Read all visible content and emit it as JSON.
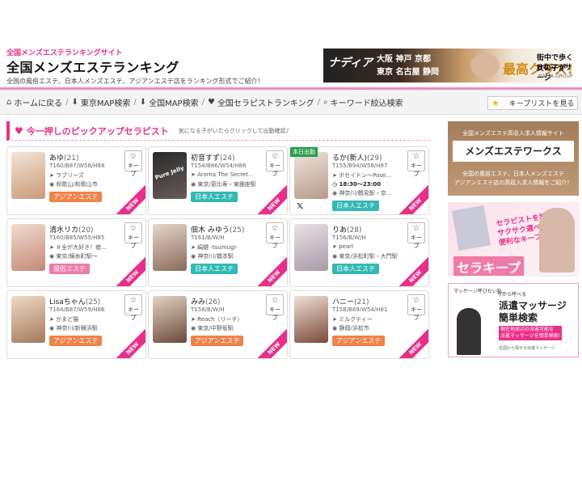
{
  "header": {
    "tagline": "全国メンズエステランキングサイト",
    "title": "全国メンズエステランキング",
    "description": "全国の風俗エステ、日本人メンズエステ、アジアンエステ店をランキング形式でご紹介！"
  },
  "top_banner": {
    "brand": "ナディア",
    "cities_line1": "大阪 神戸 京都",
    "cities_line2": "東京 名古屋 静岡",
    "highlight": "最高クラス!",
    "copy_line1": "街中で歩く女の子が",
    "copy_line2": "Hなマッサージ",
    "group": "NADIA GROUP"
  },
  "nav": {
    "items": [
      {
        "icon": "home-icon",
        "glyph": "⌂",
        "label": "ホームに戻る"
      },
      {
        "icon": "arrow-down-icon",
        "glyph": "⬇",
        "label": "東京MAP検索"
      },
      {
        "icon": "arrow-down-icon",
        "glyph": "⬇",
        "label": "全国MAP検索"
      },
      {
        "icon": "heart-icon",
        "glyph": "♥",
        "label": "全国セラピストランキング"
      },
      {
        "icon": "search-icon",
        "glyph": "⌕",
        "label": "キーワード絞込検索"
      }
    ],
    "keep_list_label": "キープリストを見る"
  },
  "section": {
    "title": "今一押しのピックアップセラピスト",
    "subtitle": "気になる子がいたらクリックして出勤確認♪"
  },
  "keep_label": "キープ",
  "new_label": "NEW",
  "today_label": "本日出勤",
  "colors": {
    "accent": "#e8308a",
    "asian": "#f0834a",
    "japanese": "#32b9b4",
    "fuzoku": "#f07aa8"
  },
  "cards": [
    {
      "name": "あゆ",
      "age": "(21)",
      "sizes": "T160/B87/W56/H88",
      "shop": "ラブリーズ",
      "area": "和歌山/和歌山市",
      "tag": "アジアンエステ",
      "tag_type": "asian",
      "photo": [
        "#f4e4d6",
        "#c89a7a"
      ]
    },
    {
      "name": "初音すず",
      "age": "(24)",
      "sizes": "T154/B86/W54/H86",
      "shop": "Aroma The Secret...",
      "area": "東京/恵比寿・東銀座駅",
      "tag": "日本人エステ",
      "tag_type": "japanese",
      "photo": [
        "#2a2a2a",
        "#6a5a5a"
      ],
      "photo_text": "Pure Jelly"
    },
    {
      "name": "るか(新人)",
      "age": "(29)",
      "sizes": "T155/B94/W58/H87",
      "shop": "ボセイドン〜Pose...",
      "hours": "18:30〜23:00",
      "area": "神奈川/鶴見駅・京...",
      "tag": "日本人エステ",
      "tag_type": "japanese",
      "today": true,
      "x": "𝕏",
      "photo": [
        "#ede4dc",
        "#b89a88"
      ]
    },
    {
      "name": "清水リカ",
      "age": "(20)",
      "sizes": "T160/B85/W55/H85",
      "shop": "＃全が大好き！癒...",
      "area": "東京/錦糸町駅〜",
      "tag": "風俗エステ",
      "tag_type": "fuzoku",
      "photo": [
        "#f2dcd2",
        "#c48a74"
      ]
    },
    {
      "name": "佃木 みゆう",
      "age": "(25)",
      "sizes": "T161/B/W/H",
      "shop": "絹鍵 -tsumugi-",
      "area": "神奈川/橋本駅",
      "tag": "日本人エステ",
      "tag_type": "japanese",
      "photo": [
        "#e6d6ca",
        "#8a6a5a"
      ]
    },
    {
      "name": "りあ",
      "age": "(28)",
      "sizes": "T156/B/W/H",
      "shop": "pearl",
      "area": "東京/浜松町駅・大門駅",
      "tag": "日本人エステ",
      "tag_type": "japanese",
      "photo": [
        "#e8e2e6",
        "#a89aa6"
      ]
    },
    {
      "name": "Lisaちゃん",
      "age": "(25)",
      "sizes": "T164/B87/W59/H86",
      "shop": "かまど猫",
      "area": "神奈川/新横浜駅",
      "tag": "アジアンエステ",
      "tag_type": "asian",
      "photo": [
        "#efd9c6",
        "#a47a5c"
      ]
    },
    {
      "name": "みみ",
      "age": "(26)",
      "sizes": "T158/B/W/H",
      "shop": "Reach（リーチ）",
      "area": "東京/中野坂駅",
      "tag": "アジアンエステ",
      "tag_type": "asian",
      "photo": [
        "#e4d2c2",
        "#6a4a3a"
      ]
    },
    {
      "name": "ハニー",
      "age": "(21)",
      "sizes": "T158/B89/W54/H81",
      "shop": "ミルクティー",
      "area": "静岡/浜松市",
      "tag": "アジアンエステ",
      "tag_type": "asian",
      "photo": [
        "#f0dfd4",
        "#7a4a3a"
      ]
    }
  ],
  "side_banners": {
    "b1_small": "全国メンズエステ高収入求人情報サイト",
    "b1_title": "メンズエステワークス",
    "b1_line1": "全国の風俗エステ、日本人メンズエステ",
    "b1_line2": "アジアンエステ店の高収入求人情報をご紹介！",
    "b2_copy_line1": "セラピストを指名で",
    "b2_copy_line2": "サクサク選べます!",
    "b2_copy_line3": "便利なキープ機能付き",
    "b2_title": "セラキープ",
    "b3_top": "マッサージ呼びたい私…",
    "b3_small": "今から呼べる",
    "b3_title_line1": "派遣マッサージ",
    "b3_title_line2": "簡単検索",
    "b3_badge_line1": "現在地周辺の派遣可能な",
    "b3_badge_line2": "派遣マッサージを簡単検索!",
    "b3_note": "全国から探せる派遣マッサージ"
  }
}
